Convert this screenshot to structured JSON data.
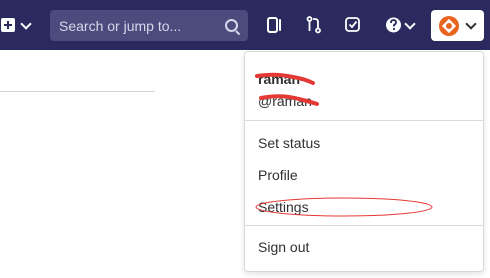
{
  "topbar": {
    "search": {
      "placeholder": "Search or jump to..."
    },
    "icons": [
      "plus-square-icon",
      "chevron-down-icon",
      "search-icon",
      "sidebar-panel-icon",
      "merge-request-icon",
      "todo-check-icon",
      "help-icon",
      "avatar"
    ],
    "colors": {
      "background": "#2a2a5e",
      "search_background": "#4b4b7e"
    }
  },
  "user_menu": {
    "name": "raman",
    "handle": "@raman",
    "items": [
      {
        "label": "Set status"
      },
      {
        "label": "Profile"
      },
      {
        "label": "Settings"
      }
    ],
    "sign_out": "Sign out",
    "annotation_color": "#e53935"
  }
}
